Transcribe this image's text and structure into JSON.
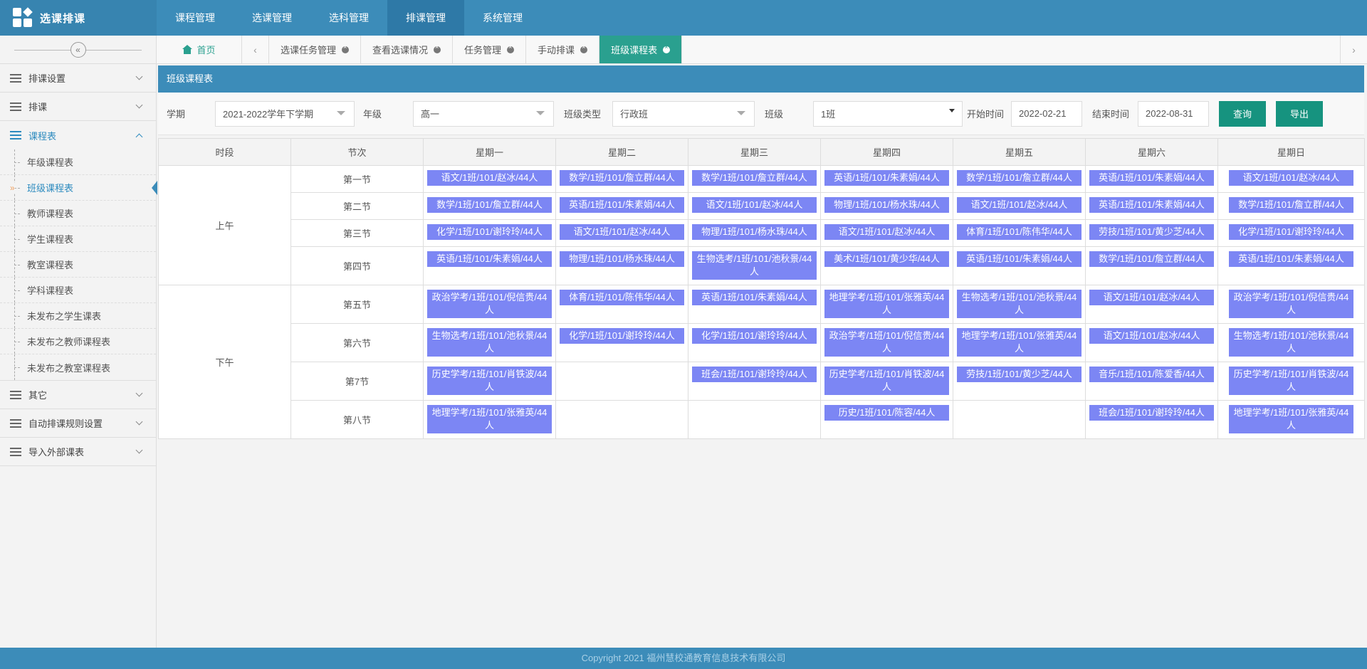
{
  "brand": {
    "title": "选课排课"
  },
  "top_nav": [
    "课程管理",
    "选课管理",
    "选科管理",
    "排课管理",
    "系统管理"
  ],
  "top_nav_active": 3,
  "sidebar": {
    "collapse_glyph": "«",
    "groups_top": [
      "排课设置",
      "排课"
    ],
    "open_group": "课程表",
    "sub_items": [
      "年级课程表",
      "班级课程表",
      "教师课程表",
      "学生课程表",
      "教室课程表",
      "学科课程表",
      "未发布之学生课表",
      "未发布之教师课程表",
      "未发布之教室课程表"
    ],
    "active_sub": 1,
    "groups_bottom": [
      "其它",
      "自动排课规则设置",
      "导入外部课表"
    ]
  },
  "tabs": {
    "home": "首页",
    "prev_glyph": "‹",
    "next_glyph": "›",
    "items": [
      "选课任务管理",
      "查看选课情况",
      "任务管理",
      "手动排课",
      "班级课程表"
    ],
    "active": 4
  },
  "panel": {
    "title": "班级课程表"
  },
  "filters": {
    "term_label": "学期",
    "term_value": "2021-2022学年下学期",
    "grade_label": "年级",
    "grade_value": "高一",
    "class_type_label": "班级类型",
    "class_type_value": "行政班",
    "class_label": "班级",
    "class_value": "1班",
    "start_label": "开始时间",
    "start_value": "2022-02-21",
    "end_label": "结束时间",
    "end_value": "2022-08-31",
    "query_label": "查询",
    "export_label": "导出"
  },
  "table": {
    "headers": [
      "时段",
      "节次",
      "星期一",
      "星期二",
      "星期三",
      "星期四",
      "星期五",
      "星期六",
      "星期日"
    ],
    "periods": [
      {
        "name": "上午",
        "rows": [
          {
            "label": "第一节",
            "cells": [
              "语文/1班/101/赵冰/44人",
              "数学/1班/101/詹立群/44人",
              "数学/1班/101/詹立群/44人",
              "英语/1班/101/朱素娟/44人",
              "数学/1班/101/詹立群/44人",
              "英语/1班/101/朱素娟/44人",
              "语文/1班/101/赵冰/44人"
            ]
          },
          {
            "label": "第二节",
            "cells": [
              "数学/1班/101/詹立群/44人",
              "英语/1班/101/朱素娟/44人",
              "语文/1班/101/赵冰/44人",
              "物理/1班/101/杨水珠/44人",
              "语文/1班/101/赵冰/44人",
              "英语/1班/101/朱素娟/44人",
              "数学/1班/101/詹立群/44人"
            ]
          },
          {
            "label": "第三节",
            "cells": [
              "化学/1班/101/谢玲玲/44人",
              "语文/1班/101/赵冰/44人",
              "物理/1班/101/杨水珠/44人",
              "语文/1班/101/赵冰/44人",
              "体育/1班/101/陈伟华/44人",
              "劳技/1班/101/黄少芝/44人",
              "化学/1班/101/谢玲玲/44人"
            ]
          },
          {
            "label": "第四节",
            "cells": [
              "英语/1班/101/朱素娟/44人",
              "物理/1班/101/杨水珠/44人",
              "生物选考/1班/101/池秋景/44人",
              "美术/1班/101/黄少华/44人",
              "英语/1班/101/朱素娟/44人",
              "数学/1班/101/詹立群/44人",
              "英语/1班/101/朱素娟/44人"
            ]
          }
        ]
      },
      {
        "name": "下午",
        "rows": [
          {
            "label": "第五节",
            "cells": [
              "政治学考/1班/101/倪信贵/44人",
              "体育/1班/101/陈伟华/44人",
              "英语/1班/101/朱素娟/44人",
              "地理学考/1班/101/张雅英/44人",
              "生物选考/1班/101/池秋景/44人",
              "语文/1班/101/赵冰/44人",
              "政治学考/1班/101/倪信贵/44人"
            ]
          },
          {
            "label": "第六节",
            "cells": [
              "生物选考/1班/101/池秋景/44人",
              "化学/1班/101/谢玲玲/44人",
              "化学/1班/101/谢玲玲/44人",
              "政治学考/1班/101/倪信贵/44人",
              "地理学考/1班/101/张雅英/44人",
              "语文/1班/101/赵冰/44人",
              "生物选考/1班/101/池秋景/44人"
            ]
          },
          {
            "label": "第7节",
            "cells": [
              "历史学考/1班/101/肖铁波/44人",
              "",
              "班会/1班/101/谢玲玲/44人",
              "历史学考/1班/101/肖铁波/44人",
              "劳技/1班/101/黄少芝/44人",
              "音乐/1班/101/陈爱香/44人",
              "历史学考/1班/101/肖铁波/44人"
            ]
          },
          {
            "label": "第八节",
            "cells": [
              "地理学考/1班/101/张雅英/44人",
              "",
              "",
              "历史/1班/101/陈容/44人",
              "",
              "班会/1班/101/谢玲玲/44人",
              "地理学考/1班/101/张雅英/44人"
            ]
          }
        ]
      }
    ]
  },
  "footer": {
    "text": "Copyright 2021 福州慧校通教育信息技术有限公司"
  },
  "colors": {
    "primary": "#3c8cb9",
    "accent": "#2aa08f",
    "course": "#7c86f4",
    "button": "#16937f"
  }
}
